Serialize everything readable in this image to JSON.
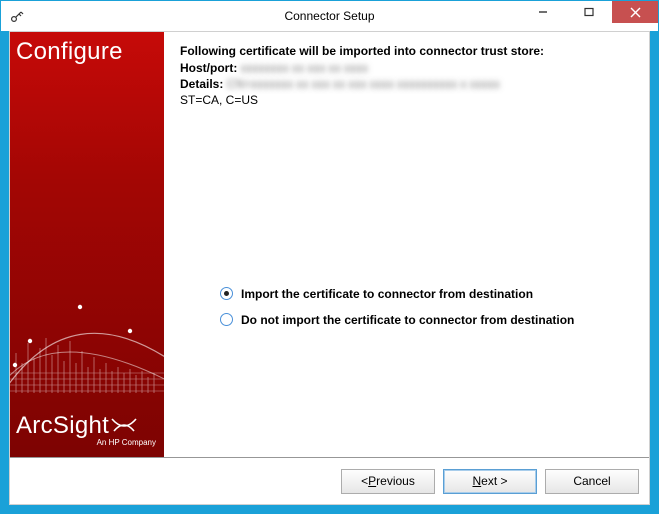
{
  "window": {
    "title": "Connector Setup"
  },
  "sidebar": {
    "title": "Configure",
    "logo": "ArcSight",
    "logo_sub": "An HP Company"
  },
  "content": {
    "heading": "Following certificate will be imported into connector trust store:",
    "host_label": "Host/port:",
    "host_value": "xxxxxxxx xx xxx xx xxxx",
    "details_label": "Details:",
    "details_value_1": "CN=xxxxxxx xx xxx xx xxx xxxx xxxxxxxxxx x xxxxx",
    "details_value_2": "ST=CA, C=US"
  },
  "options": {
    "import": "Import the certificate to connector from destination",
    "noimport": "Do not import the certificate to connector from destination",
    "selected": "import"
  },
  "buttons": {
    "previous_pre": "< ",
    "previous_u": "P",
    "previous_post": "revious",
    "next_u": "N",
    "next_post": "ext >",
    "cancel": "Cancel"
  }
}
